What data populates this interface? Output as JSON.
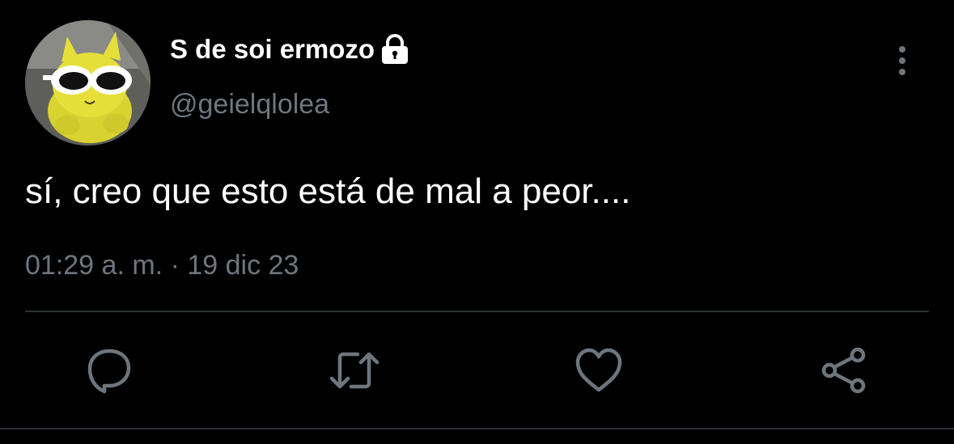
{
  "tweet": {
    "display_name": "S de soi ermozo",
    "handle": "@geielqlolea",
    "text": "sí, creo que esto está de mal a peor....",
    "time": "01:29 a. m.",
    "separator": "·",
    "date": "19 dic 23",
    "meta_line": "01:29 a. m. · 19 dic 23"
  },
  "icons": {
    "lock": "lock-icon",
    "more": "more-options-icon",
    "reply": "reply-icon",
    "retweet": "retweet-icon",
    "like": "heart-icon",
    "share": "share-icon"
  },
  "colors": {
    "background": "#000000",
    "primary_text": "#ffffff",
    "secondary_text": "#6e767d",
    "divider": "#2f3336",
    "icon": "#6e767d"
  }
}
